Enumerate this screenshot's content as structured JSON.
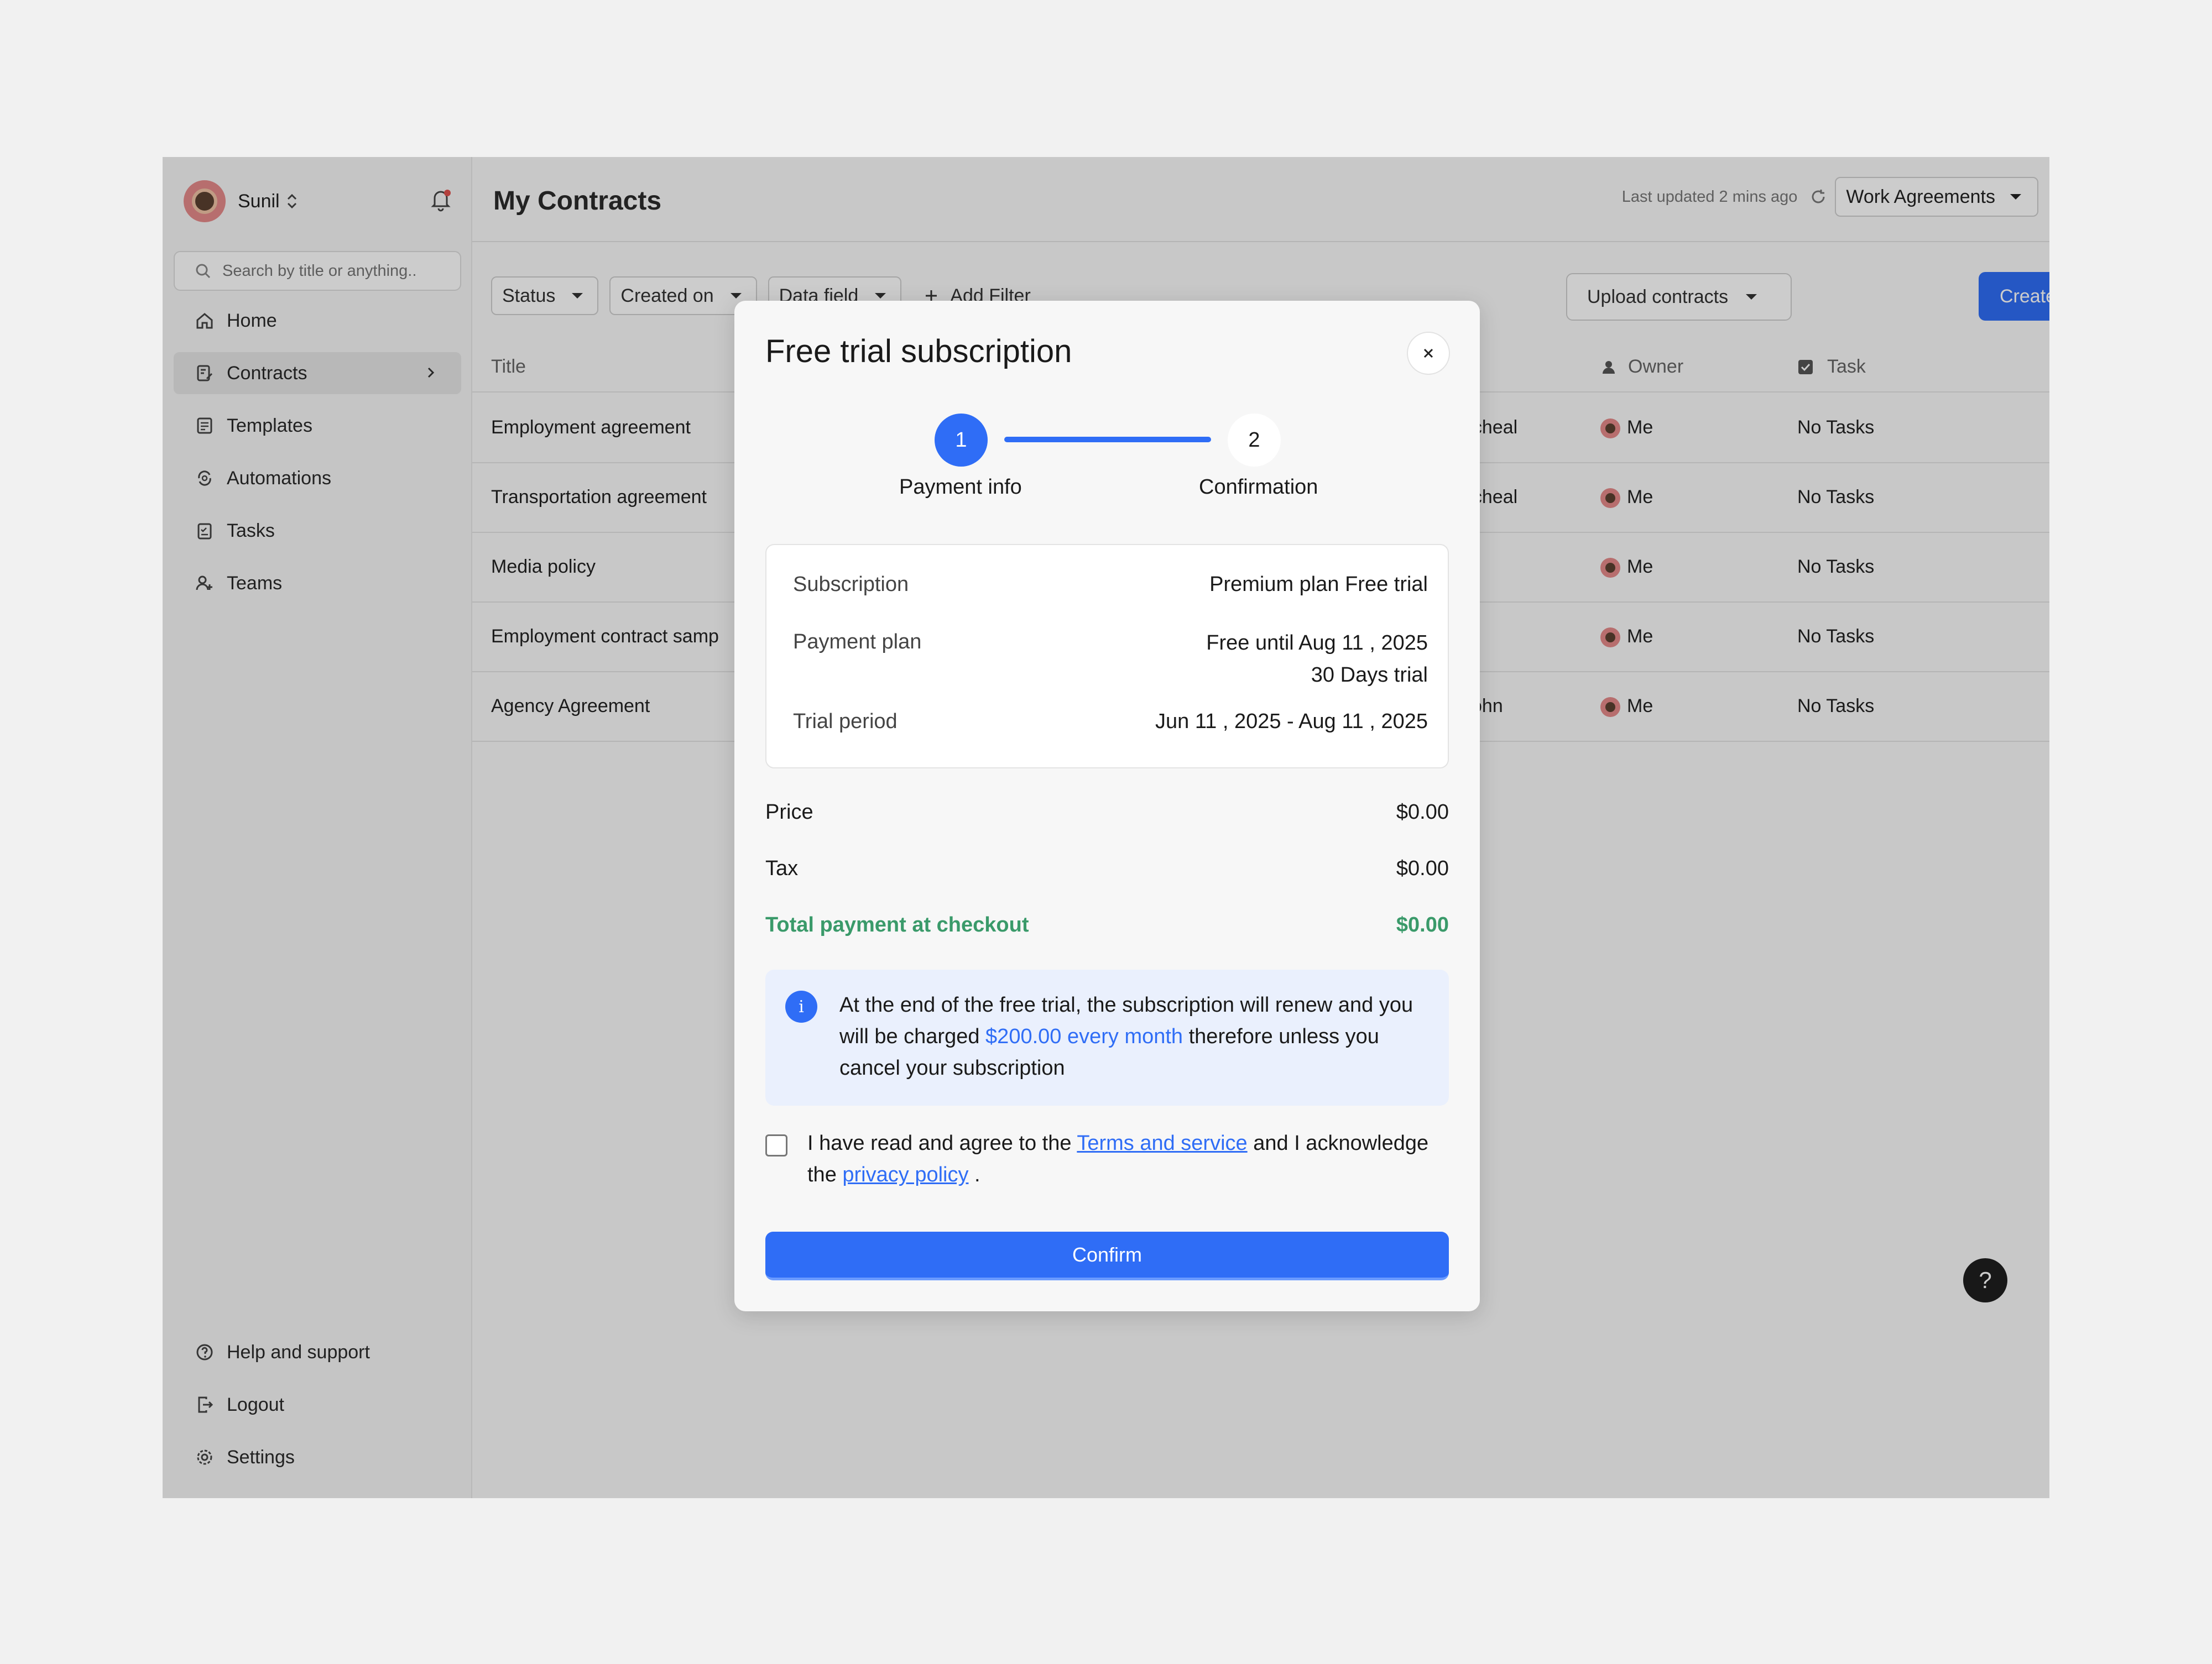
{
  "sidebar": {
    "user_name": "Sunil",
    "search_placeholder": "Search by title or anything..",
    "items": [
      {
        "label": "Home",
        "icon": "home-icon"
      },
      {
        "label": "Contracts",
        "icon": "contracts-icon"
      },
      {
        "label": "Templates",
        "icon": "templates-icon"
      },
      {
        "label": "Automations",
        "icon": "automations-icon"
      },
      {
        "label": "Tasks",
        "icon": "tasks-icon"
      },
      {
        "label": "Teams",
        "icon": "teams-icon"
      }
    ],
    "bottom_items": [
      {
        "label": "Help and support",
        "icon": "help-icon"
      },
      {
        "label": "Logout",
        "icon": "logout-icon"
      },
      {
        "label": "Settings",
        "icon": "settings-icon"
      }
    ]
  },
  "header": {
    "title": "My Contracts",
    "last_updated": "Last updated 2 mins ago",
    "workspace": "Work Agreements"
  },
  "filters": {
    "status": "Status",
    "created_on": "Created on",
    "data_field": "Data field",
    "add_filter": "Add Filter"
  },
  "actions": {
    "upload": "Upload contracts",
    "create": "Create and sign"
  },
  "table": {
    "columns": {
      "title": "Title",
      "owner": "Owner",
      "task": "Task"
    },
    "rows": [
      {
        "title": "Employment agreement",
        "party": "acheal",
        "owner": "Me",
        "task": "No Tasks"
      },
      {
        "title": "Transportation agreement",
        "party": "acheal",
        "owner": "Me",
        "task": "No Tasks"
      },
      {
        "title": "Media policy",
        "party": "",
        "owner": "Me",
        "task": "No Tasks"
      },
      {
        "title": "Employment contract samp",
        "party": "",
        "owner": "Me",
        "task": "No Tasks"
      },
      {
        "title": "Agency Agreement",
        "party": "John",
        "owner": "Me",
        "task": "No Tasks"
      }
    ]
  },
  "help_fab": "?",
  "modal": {
    "title": "Free trial subscription",
    "steps": [
      {
        "number": "1",
        "label": "Payment info"
      },
      {
        "number": "2",
        "label": "Confirmation"
      }
    ],
    "summary": {
      "subscription_label": "Subscription",
      "subscription_value": "Premium plan Free trial",
      "payment_plan_label": "Payment plan",
      "payment_plan_value_1": "Free until Aug 11 , 2025",
      "payment_plan_value_2": "30 Days trial",
      "trial_period_label": "Trial period",
      "trial_period_value": "Jun 11 , 2025 - Aug 11 , 2025"
    },
    "price_label": "Price",
    "price_value": "$0.00",
    "tax_label": "Tax",
    "tax_value": "$0.00",
    "total_label": "Total payment at checkout",
    "total_value": "$0.00",
    "info": {
      "text_1": "At the end of the free trial, the subscription will renew and you will be charged ",
      "highlight": "$200.00 every month",
      "text_2": " therefore unless you cancel your subscription"
    },
    "agree": {
      "text_1": "I have read and agree to the ",
      "terms_link": "Terms and service",
      "text_2": " and I acknowledge the ",
      "privacy_link": "privacy policy",
      "text_3": " ."
    },
    "confirm": "Confirm"
  },
  "colors": {
    "accent": "#2f6df6",
    "total_green": "#3a9a6a",
    "info_bg": "#eaf0fd"
  }
}
